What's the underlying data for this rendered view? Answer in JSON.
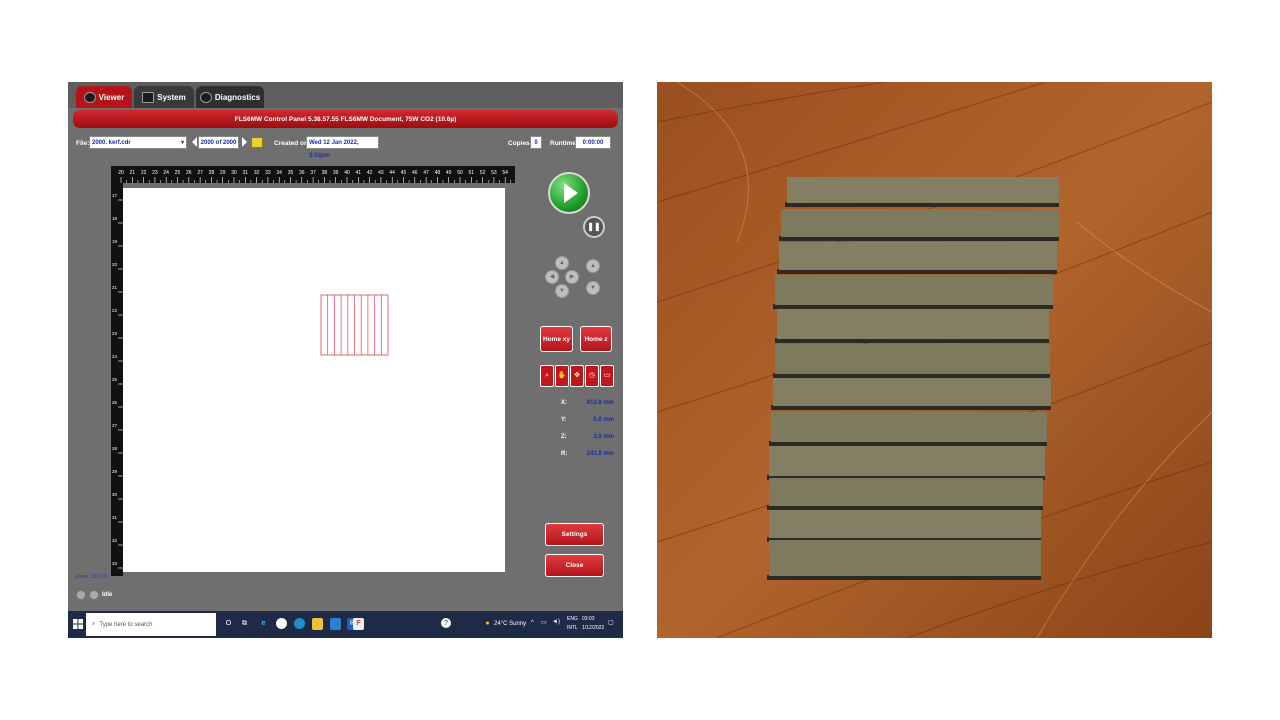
{
  "tabs": [
    {
      "label": "Viewer",
      "icon": "eye-icon"
    },
    {
      "label": "System",
      "icon": "system-icon"
    },
    {
      "label": "Diagnostics",
      "icon": "diagnostics-icon"
    }
  ],
  "title_bar": "FLS6MW Control Panel  5.38.57.55   FLS6MW Document, 75W CO2 (10.6µ)",
  "file_row": {
    "file_label": "File:",
    "file_value": "2000. kerf.cdr",
    "page_value": "2000 of 2000",
    "created_label": "Created on:",
    "created_value": "Wed 12 Jan 2022,  3:03pm",
    "copies_label": "Copies:",
    "copies_value": "0",
    "runtime_label": "Runtime:",
    "runtime_value": "0:00:00"
  },
  "ruler": {
    "top_ticks": [
      "20",
      "21",
      "22",
      "23",
      "24",
      "25",
      "26",
      "27",
      "28",
      "29",
      "30",
      "31",
      "32",
      "33",
      "34",
      "35",
      "36",
      "37",
      "38",
      "39",
      "40",
      "41",
      "42",
      "43",
      "44",
      "45",
      "46",
      "47",
      "48",
      "49",
      "50",
      "51",
      "52",
      "53",
      "54"
    ],
    "left_ticks": [
      "17",
      "18",
      "19",
      "20",
      "21",
      "22",
      "23",
      "24",
      "25",
      "26",
      "27",
      "28",
      "29",
      "30",
      "31",
      "32",
      "33"
    ]
  },
  "design": {
    "line_count": 10,
    "color": "#e2424c"
  },
  "controls": {
    "home_xy": "Home xy",
    "home_z": "Home z",
    "settings": "Settings",
    "close": "Close",
    "tool_icons": [
      "zoom-icon",
      "pan-icon",
      "center-icon",
      "estimate-icon",
      "page-icon"
    ]
  },
  "coords": [
    {
      "label": "X:",
      "value": "812.8 mm"
    },
    {
      "label": "Y:",
      "value": "0.0 mm"
    },
    {
      "label": "Z:",
      "value": "3.0 mm"
    },
    {
      "label": "R:",
      "value": "243.8 mm"
    }
  ],
  "zoom_text": "Zoom: 237.9%",
  "status_text": "Idle",
  "taskbar": {
    "search_placeholder": "Type here to search",
    "weather": "24°C  Sunny",
    "lang_line1": "ENG",
    "lang_line2": "INTL",
    "time": "03:03",
    "date": "1/12/2022"
  },
  "colors": {
    "accent_red": "#b31319",
    "panel_gray": "#6f6f6f",
    "value_blue": "#1a2bb5"
  }
}
